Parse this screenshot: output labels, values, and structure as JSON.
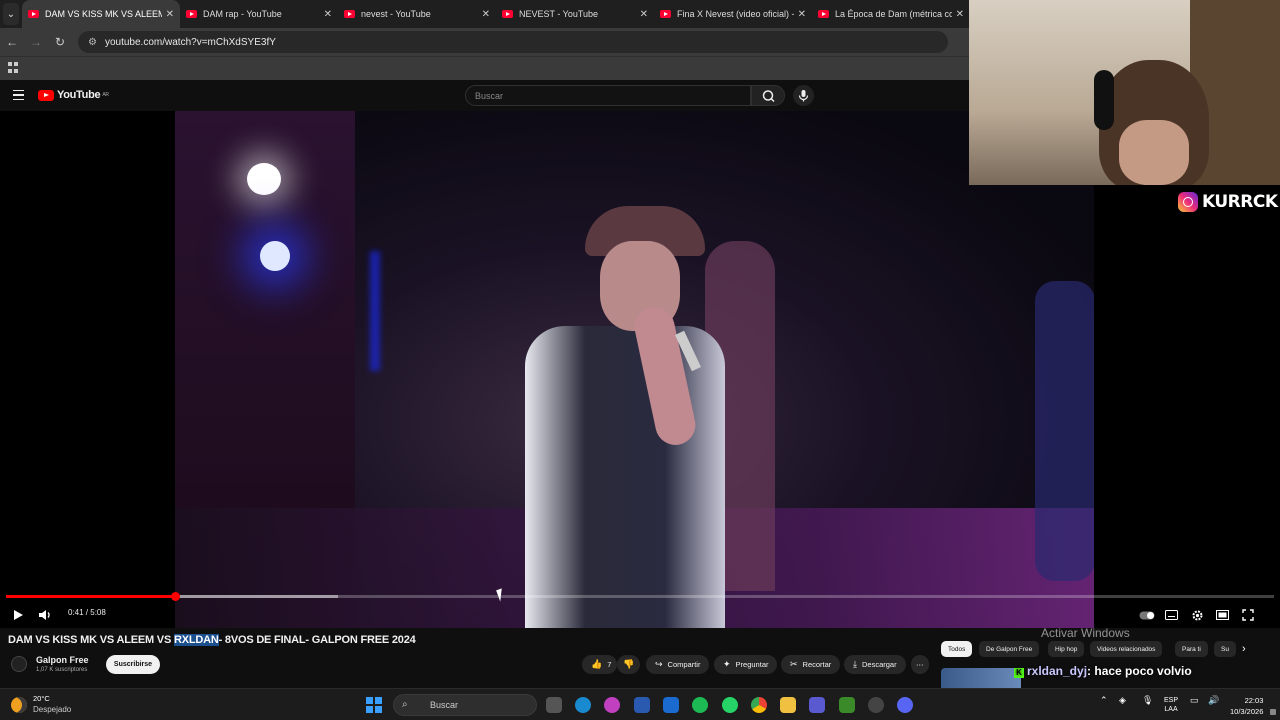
{
  "browser": {
    "tabs": [
      {
        "title": "DAM VS KISS MK VS ALEEM VS",
        "active": true
      },
      {
        "title": "DAM rap - YouTube",
        "active": false
      },
      {
        "title": "nevest - YouTube",
        "active": false
      },
      {
        "title": "NEVEST - YouTube",
        "active": false
      },
      {
        "title": "Fina X Nevest (video oficial) - Y",
        "active": false
      },
      {
        "title": "La Época de Dam (métrica con",
        "active": false
      }
    ],
    "url": "youtube.com/watch?v=mChXdSYE3fY"
  },
  "youtube": {
    "logo": "YouTube",
    "country": "AR",
    "search_placeholder": "Buscar"
  },
  "player": {
    "current_time": "0:41",
    "duration": "5:08",
    "time_display": "0:41 / 5:08",
    "progress_fraction": 0.133,
    "buffer_fraction": 0.262
  },
  "video": {
    "title_before": "DAM VS KISS MK VS ALEEM VS ",
    "title_highlight": "RXLDAN",
    "title_after": "- 8VOS DE FINAL- GALPON FREE 2024",
    "channel": "Galpon Free",
    "subscribers": "1,07 K suscriptores",
    "subscribe_label": "Suscribirse",
    "likes": "7",
    "share_label": "Compartir",
    "ask_label": "Preguntar",
    "clip_label": "Recortar",
    "download_label": "Descargar"
  },
  "sidebar_chips": [
    "Todos",
    "De Galpon Free",
    "Hip hop",
    "Videos relacionados",
    "Para ti",
    "Su"
  ],
  "overlay": {
    "activate_windows": "Activar Windows",
    "chat_user": "rxldan_dyj",
    "chat_message": ": hace poco volvio",
    "instagram_handle": "KURRCK"
  },
  "taskbar": {
    "temperature": "20°C",
    "weather": "Despejado",
    "search_label": "Buscar",
    "language": "ESP",
    "layout": "LAA",
    "time": "22:03",
    "date": "10/3/2026"
  }
}
